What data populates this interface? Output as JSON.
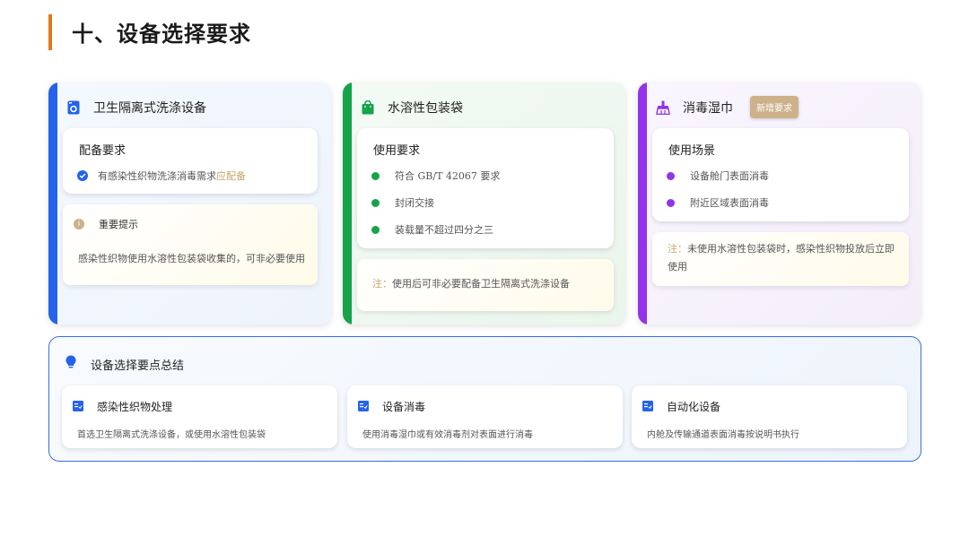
{
  "header": {
    "title": "十、设备选择要求"
  },
  "cards": [
    {
      "title": "卫生隔离式洗涤设备",
      "box": {
        "title": "配备要求",
        "item_text": "有感染性织物洗涤消毒需求",
        "item_highlight": "应配备"
      },
      "note": {
        "title": "重要提示",
        "text": "感染性织物使用水溶性包装袋收集的，可非必要使用"
      }
    },
    {
      "title": "水溶性包装袋",
      "box": {
        "title": "使用要求",
        "items": [
          "符合 GB/T 42067 要求",
          "封闭交接",
          "装载量不超过四分之三"
        ]
      },
      "note": {
        "prefix": "注：",
        "text": "使用后可非必要配备卫生隔离式洗涤设备"
      }
    },
    {
      "title": "消毒湿巾",
      "tag": "新增要求",
      "box": {
        "title": "使用场景",
        "items": [
          "设备舱门表面消毒",
          "附近区域表面消毒"
        ]
      },
      "note": {
        "prefix": "注：",
        "line1": "未使用水溶性包装袋时，感染性织物投放后立即",
        "line2": "使用"
      }
    }
  ],
  "summary": {
    "title": "设备选择要点总结",
    "items": [
      {
        "title": "感染性织物处理",
        "text": "首选卫生隔离式洗涤设备，或使用水溶性包装袋"
      },
      {
        "title": "设备消毒",
        "text": "使用消毒湿巾或有效消毒剂对表面进行消毒"
      },
      {
        "title": "自动化设备",
        "text": "内舱及传输通道表面消毒按说明书执行"
      }
    ]
  },
  "colors": {
    "accent_orange": "#e07b1a",
    "blue": "#2563eb",
    "green": "#16a34a",
    "purple": "#9333ea",
    "gold": "#c7a46c"
  }
}
